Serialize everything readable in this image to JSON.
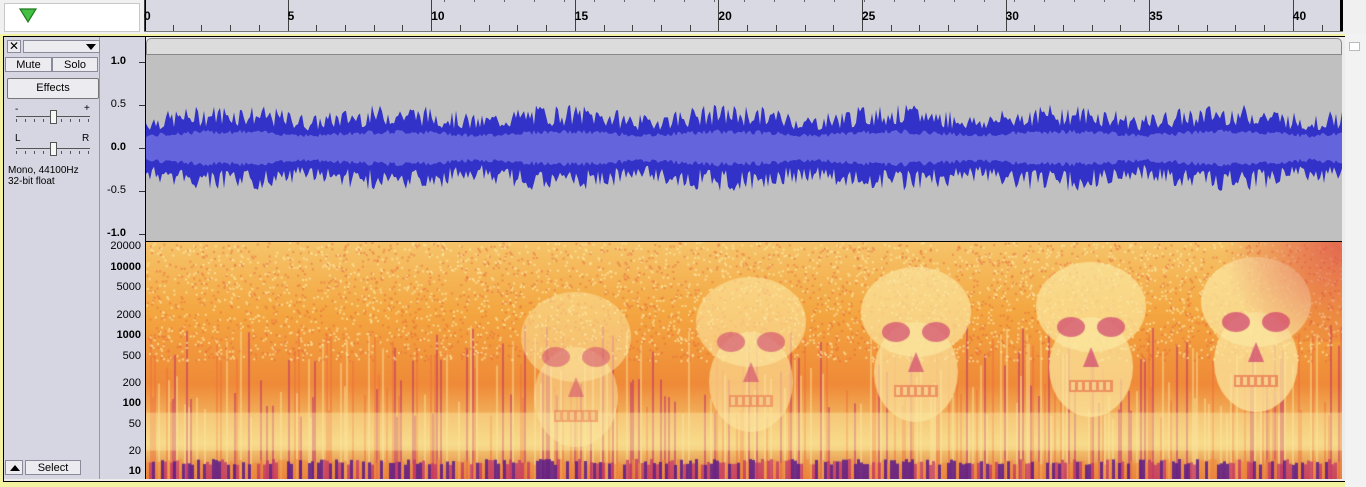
{
  "timeline": {
    "play_indicator_icon": "play-triangle-icon",
    "labels": [
      "0",
      "5",
      "10",
      "15",
      "20",
      "25",
      "30",
      "35",
      "40"
    ],
    "seconds_per_label": 5,
    "total_seconds": 41.7
  },
  "track": {
    "close_label": "✕",
    "name_menu_label": "",
    "mute_label": "Mute",
    "solo_label": "Solo",
    "effects_label": "Effects",
    "gain_minus": "-",
    "gain_plus": "+",
    "gain_value": 0.5,
    "pan_left": "L",
    "pan_right": "R",
    "pan_value": 0.5,
    "info_line1": "Mono, 44100Hz",
    "info_line2": "32-bit float",
    "select_label": "Select",
    "collapse_icon": "collapse-up-arrow-icon"
  },
  "waveform_scale": {
    "labels": [
      "1.0",
      "0.5",
      "0.0",
      "-0.5",
      "-1.0"
    ],
    "bold": [
      true,
      false,
      true,
      false,
      true
    ]
  },
  "spectrogram_scale": {
    "labels": [
      "20000",
      "10000",
      "5000",
      "2000",
      "1000",
      "500",
      "200",
      "100",
      "50",
      "20",
      "10"
    ],
    "bold": [
      false,
      true,
      false,
      false,
      true,
      false,
      false,
      true,
      false,
      false,
      true
    ]
  },
  "colors": {
    "waveform_peak": "#3232c8",
    "waveform_rms": "#6464dc",
    "waveform_bg": "#c0c0c0",
    "spectrogram_hot": "#fbe7a0",
    "spectrogram_mid": "#f4a640",
    "spectrogram_low": "#c0306a",
    "spectrogram_cold": "#5a1a8a",
    "track_area_bg": "#f2f2a0"
  }
}
